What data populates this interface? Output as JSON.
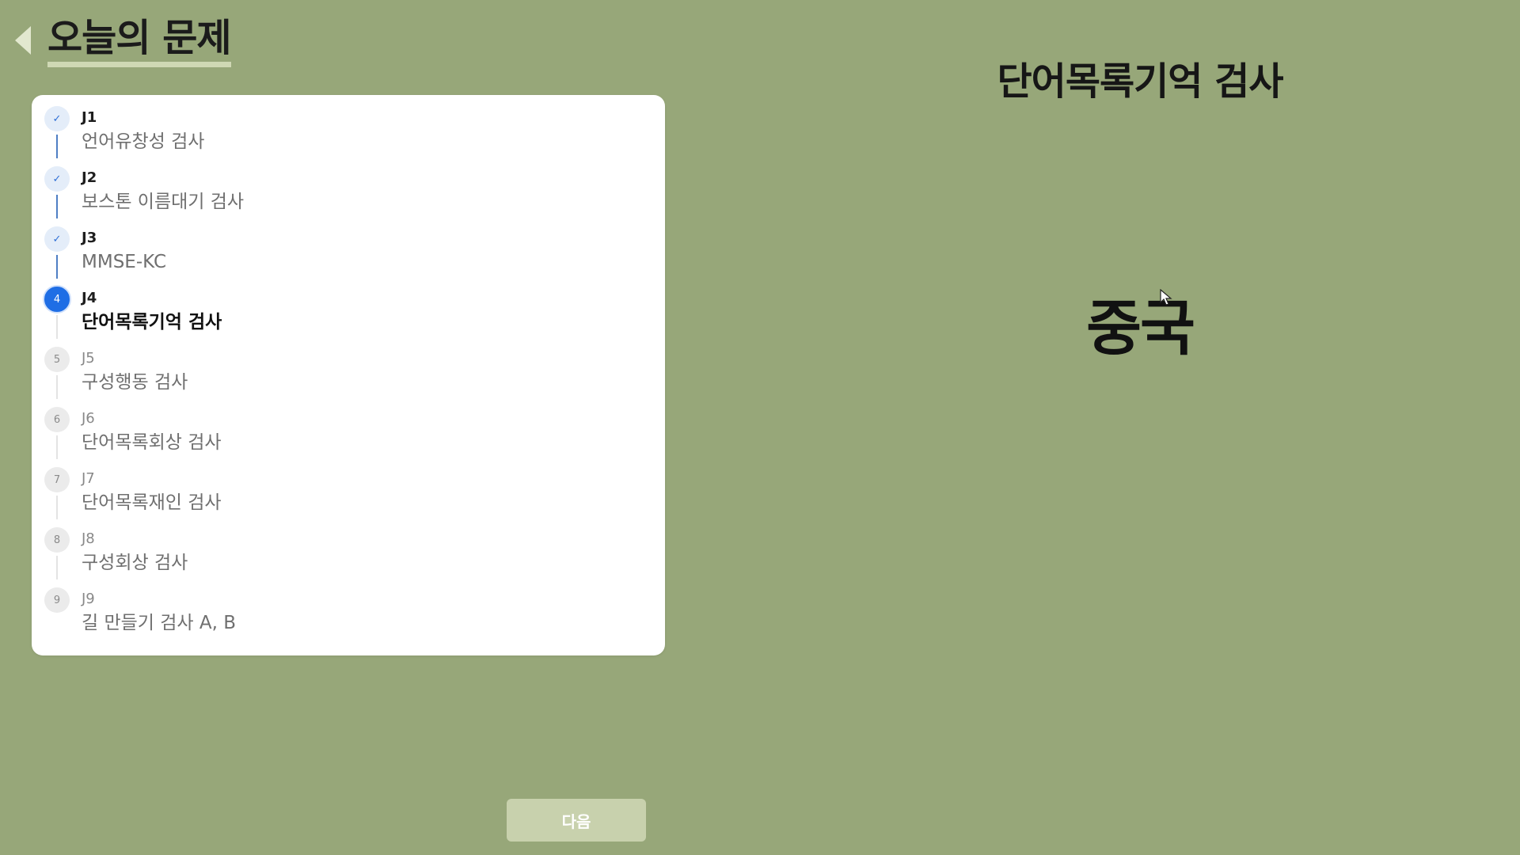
{
  "header": {
    "title": "오늘의 문제",
    "back_icon": "chevron-left-icon"
  },
  "colors": {
    "background": "#97a779",
    "accent": "#1f6ee5",
    "done_circle": "#e4edf9",
    "next_button": "#c8d1ad"
  },
  "steps": [
    {
      "code": "J1",
      "name": "언어유창성 검사",
      "status": "done",
      "marker": "✓"
    },
    {
      "code": "J2",
      "name": "보스톤 이름대기 검사",
      "status": "done",
      "marker": "✓"
    },
    {
      "code": "J3",
      "name": "MMSE-KC",
      "status": "done",
      "marker": "✓"
    },
    {
      "code": "J4",
      "name": "단어목록기억 검사",
      "status": "current",
      "marker": "4"
    },
    {
      "code": "J5",
      "name": "구성행동 검사",
      "status": "pending",
      "marker": "5"
    },
    {
      "code": "J6",
      "name": "단어목록회상 검사",
      "status": "pending",
      "marker": "6"
    },
    {
      "code": "J7",
      "name": "단어목록재인 검사",
      "status": "pending",
      "marker": "7"
    },
    {
      "code": "J8",
      "name": "구성회상 검사",
      "status": "pending",
      "marker": "8"
    },
    {
      "code": "J9",
      "name": "길 만들기 검사 A, B",
      "status": "pending",
      "marker": "9"
    }
  ],
  "main": {
    "test_title": "단어목록기억 검사",
    "word": "중국"
  },
  "footer": {
    "next_label": "다음"
  }
}
